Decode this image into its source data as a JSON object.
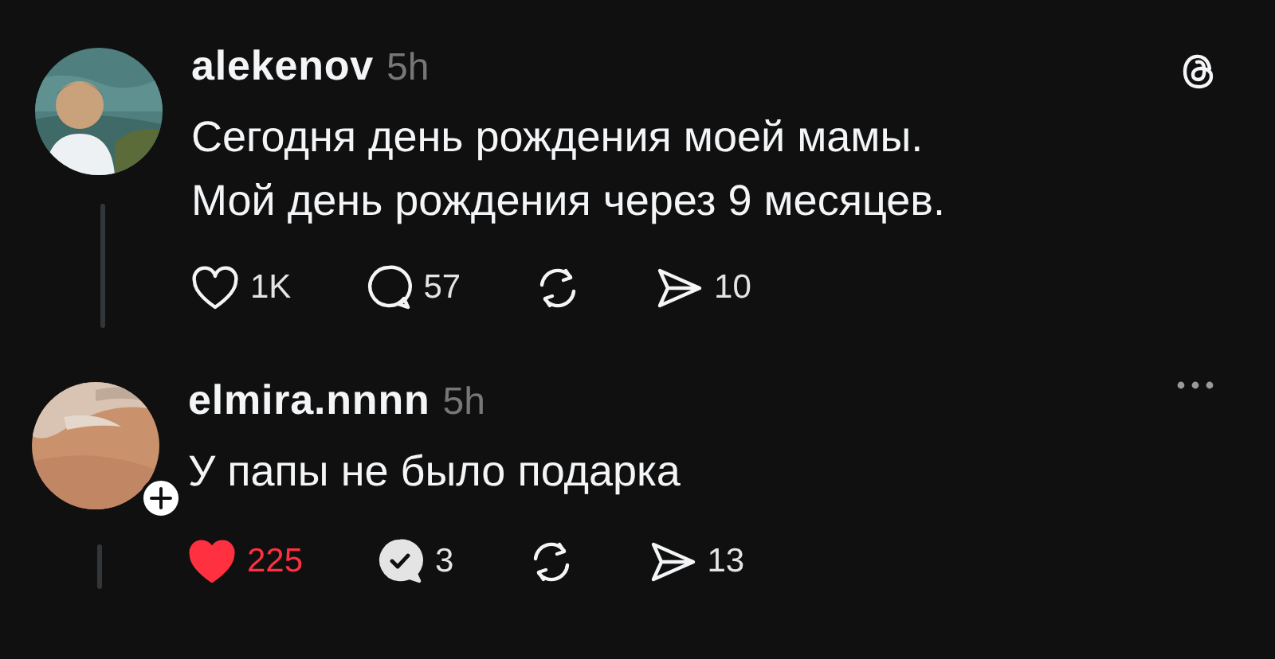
{
  "posts": [
    {
      "kind": "root",
      "username": "alekenov",
      "time": "5h",
      "follow_badge": false,
      "lines": [
        "Сегодня день рождения моей мамы.",
        "Мой день рождения через 9 месяцев."
      ],
      "actions": [
        {
          "kind": "like",
          "count": "1K",
          "selected": false
        },
        {
          "kind": "reply",
          "count": "57",
          "checked": false
        },
        {
          "kind": "repost"
        },
        {
          "kind": "share",
          "count": "10"
        }
      ]
    },
    {
      "kind": "reply",
      "username": "elmira.nnnn",
      "time": "5h",
      "follow_badge": true,
      "lines": [
        "У папы не было подарка"
      ],
      "actions": [
        {
          "kind": "like",
          "count": "225",
          "selected": true
        },
        {
          "kind": "reply",
          "count": "3",
          "checked": true
        },
        {
          "kind": "repost"
        },
        {
          "kind": "share",
          "count": "13"
        }
      ]
    }
  ]
}
